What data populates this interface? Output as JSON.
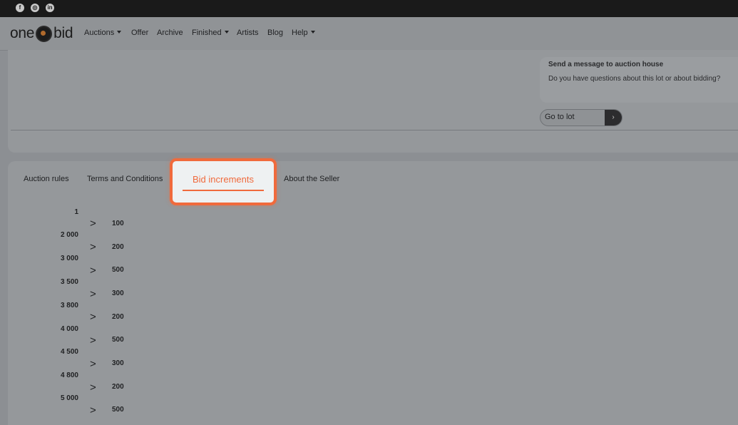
{
  "social": {
    "icons": [
      "facebook-icon",
      "instagram-icon",
      "linkedin-icon"
    ]
  },
  "logo": {
    "left": "one",
    "right": "bid"
  },
  "nav": {
    "items": [
      {
        "label": "Auctions",
        "dropdown": true
      },
      {
        "label": "Offer",
        "dropdown": false
      },
      {
        "label": "Archive",
        "dropdown": false
      },
      {
        "label": "Finished",
        "dropdown": true
      },
      {
        "label": "Artists",
        "dropdown": false
      },
      {
        "label": "Blog",
        "dropdown": false
      },
      {
        "label": "Help",
        "dropdown": true
      }
    ]
  },
  "message": {
    "title": "Send a message to auction house",
    "text": "Do you have questions about this lot or about bidding?"
  },
  "goto": {
    "label": "Go to lot",
    "arrow": "›"
  },
  "tabs": {
    "items": [
      "Auction rules",
      "Terms and Conditions",
      "Bid increments",
      "About the Seller"
    ],
    "active": "Bid increments"
  },
  "increments": {
    "thresholds": [
      "1",
      "2 000",
      "3 000",
      "3 500",
      "3 800",
      "4 000",
      "4 500",
      "4 800",
      "5 000"
    ],
    "arrow": ">",
    "steps": [
      "100",
      "200",
      "500",
      "300",
      "200",
      "500",
      "300",
      "200",
      "500"
    ]
  },
  "colors": {
    "accent": "#f06a3c",
    "overlay": "#8c8f93",
    "topbar": "#1a1a1a"
  }
}
